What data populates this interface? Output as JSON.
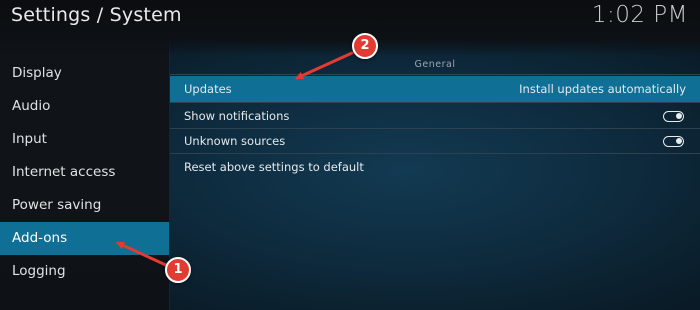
{
  "header": {
    "title": "Settings / System",
    "clock": "1:02 PM"
  },
  "sidebar": {
    "items": [
      {
        "label": "Display",
        "active": false
      },
      {
        "label": "Audio",
        "active": false
      },
      {
        "label": "Input",
        "active": false
      },
      {
        "label": "Internet access",
        "active": false
      },
      {
        "label": "Power saving",
        "active": false
      },
      {
        "label": "Add-ons",
        "active": true
      },
      {
        "label": "Logging",
        "active": false
      }
    ]
  },
  "main": {
    "section_title": "General",
    "settings": [
      {
        "label": "Updates",
        "value": "Install updates automatically",
        "focused": true
      },
      {
        "label": "Show notifications",
        "toggle": true
      },
      {
        "label": "Unknown sources",
        "toggle": true
      }
    ],
    "reset_label": "Reset above settings to default"
  },
  "annotations": {
    "badge_1": "1",
    "badge_2": "2"
  },
  "colors": {
    "accent": "#0f6f95",
    "annotation": "#e23b31"
  }
}
